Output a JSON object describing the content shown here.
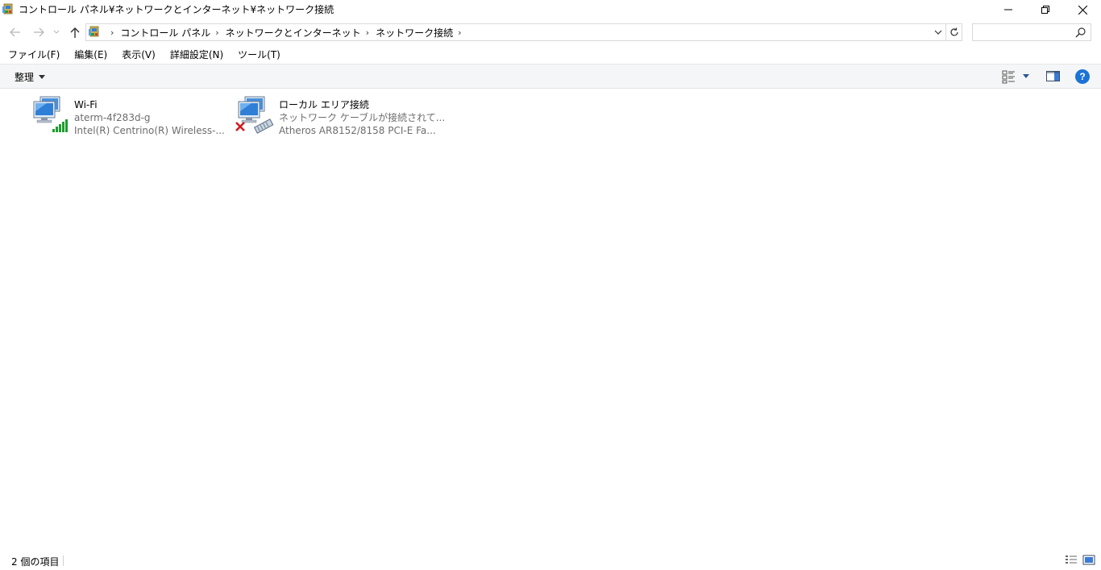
{
  "window": {
    "title": "コントロール パネル¥ネットワークとインターネット¥ネットワーク接続"
  },
  "address": {
    "crumbs": [
      "コントロール パネル",
      "ネットワークとインターネット",
      "ネットワーク接続"
    ],
    "search_placeholder": ""
  },
  "menu": {
    "items": [
      "ファイル(F)",
      "編集(E)",
      "表示(V)",
      "詳細設定(N)",
      "ツール(T)"
    ]
  },
  "command": {
    "organize": "整理"
  },
  "connections": [
    {
      "name": "Wi-Fi",
      "status": "aterm-4f283d-g",
      "device": "Intel(R) Centrino(R) Wireless-...",
      "icon": "wifi-adapter-icon"
    },
    {
      "name": "ローカル エリア接続",
      "status": "ネットワーク ケーブルが接続されて...",
      "device": "Atheros AR8152/8158 PCI-E Fa...",
      "icon": "ethernet-adapter-disconnected-icon"
    }
  ],
  "status": {
    "item_count": "2 個の項目"
  },
  "colors": {
    "accent": "#1e73d6",
    "cmdbar_bg": "#f5f6f7",
    "error_red": "#d01e1e",
    "signal_green": "#1e9e2e"
  }
}
